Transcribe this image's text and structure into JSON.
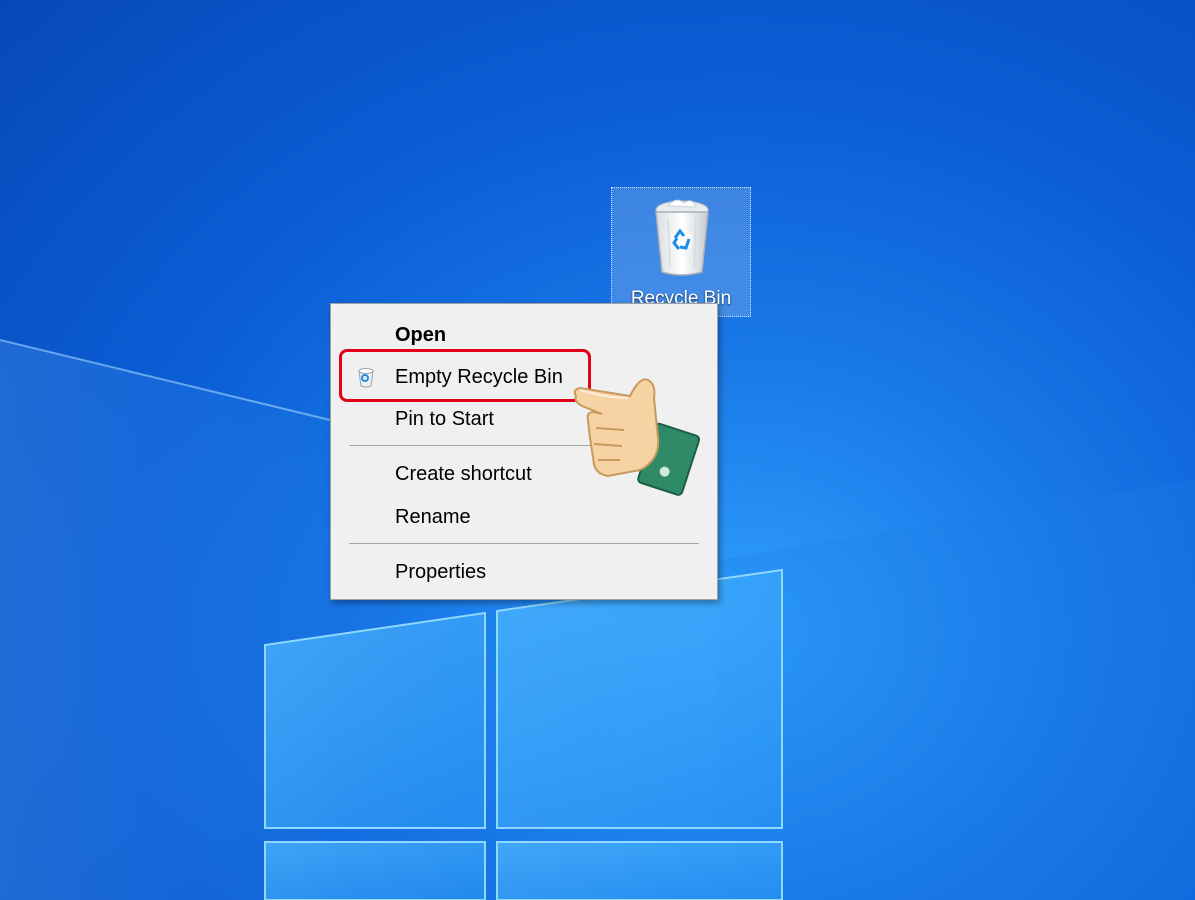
{
  "desktop": {
    "icon": {
      "label": "Recycle Bin",
      "icon_name": "recycle-bin-icon"
    }
  },
  "context_menu": {
    "items": [
      {
        "label": "Open",
        "bold": true
      },
      {
        "label": "Empty Recycle Bin",
        "icon_name": "recycle-bin-small-icon",
        "highlighted": true
      },
      {
        "label": "Pin to Start"
      },
      {
        "label": "Create shortcut"
      },
      {
        "label": "Rename"
      },
      {
        "label": "Properties"
      }
    ]
  },
  "annotation": {
    "highlight_color": "#e2001a",
    "pointer": "pointing-hand-icon"
  },
  "colors": {
    "desktop_blue": "#0b5ed6",
    "menu_background": "#f0f0f0"
  }
}
